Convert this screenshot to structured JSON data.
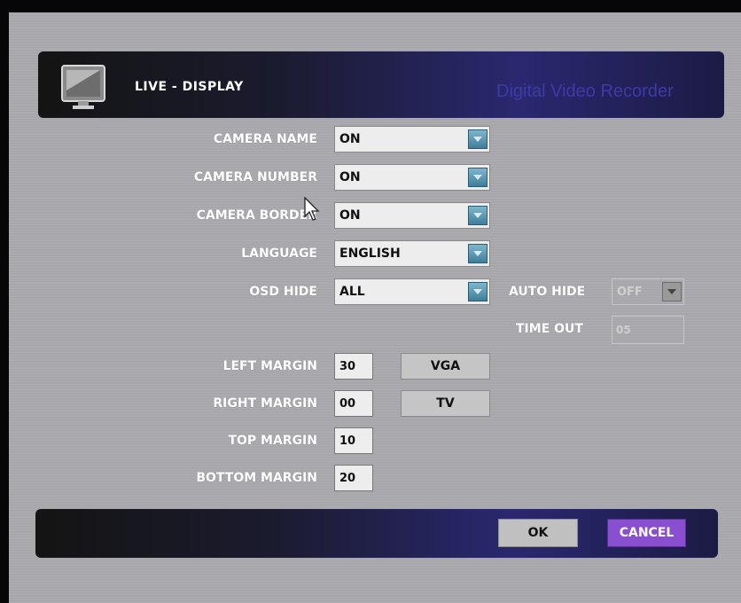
{
  "header": {
    "title": "LIVE - DISPLAY",
    "brand": "Digital Video Recorder"
  },
  "settings": [
    {
      "label": "CAMERA NAME",
      "value": "ON"
    },
    {
      "label": "CAMERA NUMBER",
      "value": "ON"
    },
    {
      "label": "CAMERA BORDER",
      "value": "ON"
    },
    {
      "label": "LANGUAGE",
      "value": "ENGLISH"
    },
    {
      "label": "OSD HIDE",
      "value": "ALL"
    }
  ],
  "auto_hide": {
    "label": "AUTO HIDE",
    "value": "OFF"
  },
  "time_out": {
    "label": "TIME OUT",
    "value": "05"
  },
  "margins": [
    {
      "label": "LEFT MARGIN",
      "value": "30"
    },
    {
      "label": "RIGHT MARGIN",
      "value": "00"
    },
    {
      "label": "TOP MARGIN",
      "value": "10"
    },
    {
      "label": "BOTTOM MARGIN",
      "value": "20"
    }
  ],
  "output_buttons": {
    "vga": "VGA",
    "tv": "TV"
  },
  "actions": {
    "ok": "OK",
    "cancel": "CANCEL"
  },
  "colors": {
    "accent": "#8a4fd0",
    "dropdown_arrow": "#4f8fab",
    "brand_text": "#3e3aa6"
  }
}
